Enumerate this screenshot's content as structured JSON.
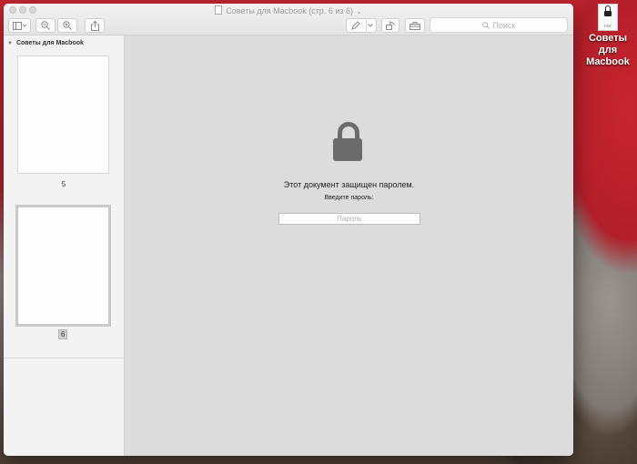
{
  "window": {
    "title": "Советы для Macbook (стр. 6 из 6)"
  },
  "toolbar": {
    "search_placeholder": "Поиск"
  },
  "sidebar": {
    "header": "Советы для Macbook",
    "pages": [
      {
        "label": "5",
        "selected": false
      },
      {
        "label": "6",
        "selected": true
      }
    ]
  },
  "main": {
    "message": "Этот документ защищен паролем.",
    "prompt": "Введите пароль:",
    "password_placeholder": "Пароль"
  },
  "desktop": {
    "file_ext": "PDF",
    "file_label": "Советы для Macbook"
  },
  "icons": [
    "sidebar-toggle-icon",
    "zoom-out-icon",
    "zoom-in-icon",
    "share-icon",
    "markup-pen-icon",
    "rotate-icon",
    "toolbox-icon",
    "search-icon",
    "lock-icon"
  ]
}
